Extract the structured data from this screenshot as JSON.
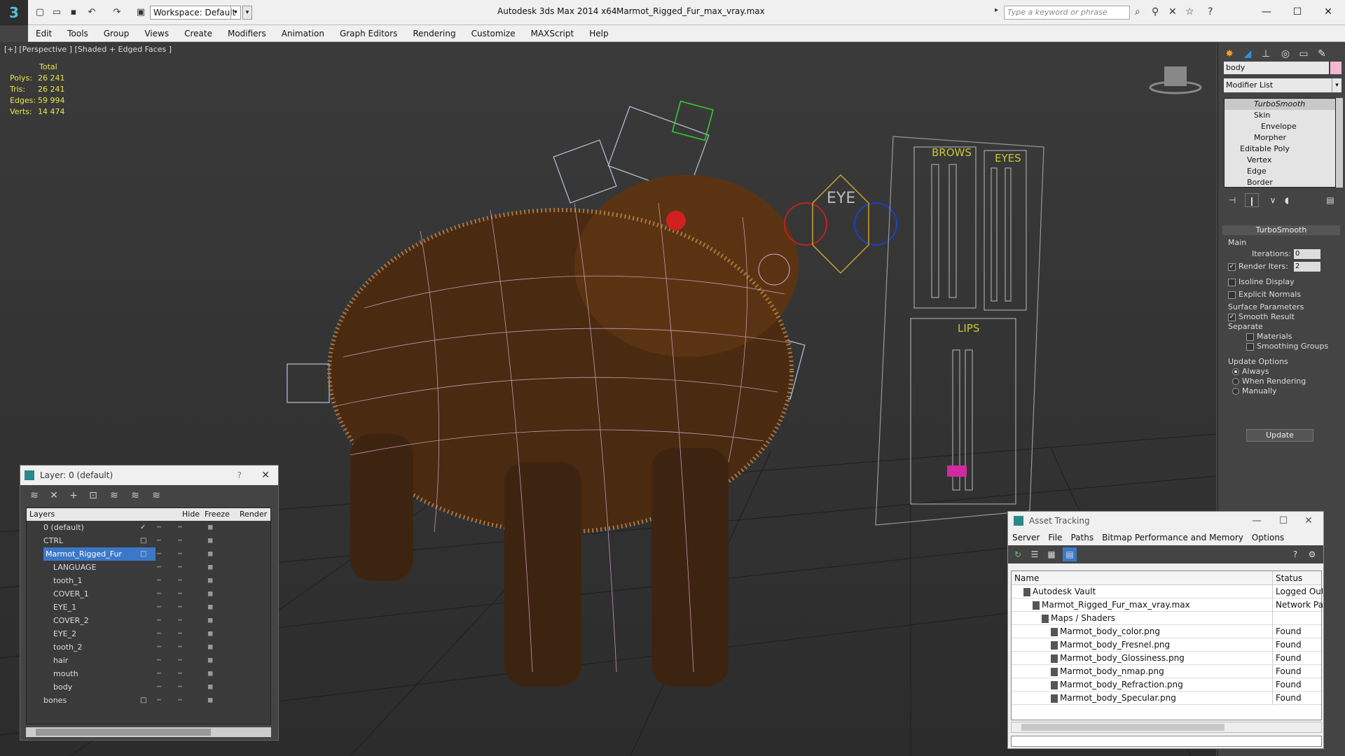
{
  "titlebar": {
    "workspace": "Workspace: Default",
    "app_title": "Autodesk 3ds Max  2014 x64",
    "file_title": "Marmot_Rigged_Fur_max_vray.max",
    "search_placeholder": "Type a keyword or phrase"
  },
  "menu": [
    "Edit",
    "Tools",
    "Group",
    "Views",
    "Create",
    "Modifiers",
    "Animation",
    "Graph Editors",
    "Rendering",
    "Customize",
    "MAXScript",
    "Help"
  ],
  "viewport": {
    "label": "[+] [Perspective ] [Shaded + Edged Faces ]",
    "stats": {
      "header": "Total",
      "rows": [
        [
          "Polys:",
          "26 241"
        ],
        [
          "Tris:",
          "26 241"
        ],
        [
          "Edges:",
          "59 994"
        ],
        [
          "Verts:",
          "14 474"
        ]
      ]
    },
    "board_labels": {
      "brows": "BROWS",
      "eyes": "EYES",
      "lips": "LIPS",
      "eye": "EYE"
    }
  },
  "command_panel": {
    "object_name": "body",
    "object_color": "#f2b8d2",
    "modifier_list": "Modifier List",
    "stack": [
      "TurboSmooth",
      "Skin",
      "Envelope",
      "Morpher",
      "Editable Poly",
      "Vertex",
      "Edge",
      "Border"
    ],
    "rollout": "TurboSmooth",
    "main_label": "Main",
    "iterations_label": "Iterations:",
    "iterations": "0",
    "render_iters_label": "Render Iters:",
    "render_iters": "2",
    "isoline": "Isoline Display",
    "explicit": "Explicit Normals",
    "surface_label": "Surface Parameters",
    "smooth_result": "Smooth Result",
    "separate": "Separate",
    "materials": "Materials",
    "smoothing_groups": "Smoothing Groups",
    "update_options": "Update Options",
    "always": "Always",
    "when_rendering": "When Rendering",
    "manually": "Manually",
    "update_btn": "Update"
  },
  "layer_dialog": {
    "title": "Layer: 0 (default)",
    "help": "?",
    "columns": {
      "layers": "Layers",
      "hide": "Hide",
      "freeze": "Freeze",
      "render": "Render"
    },
    "rows": [
      {
        "name": "0 (default)",
        "indent": 0,
        "check": "✓"
      },
      {
        "name": "CTRL",
        "indent": 0,
        "check": "□"
      },
      {
        "name": "Marmot_Rigged_Fur",
        "indent": 0,
        "check": "□",
        "selected": true
      },
      {
        "name": "LANGUAGE",
        "indent": 1,
        "check": ""
      },
      {
        "name": "tooth_1",
        "indent": 1,
        "check": ""
      },
      {
        "name": "COVER_1",
        "indent": 1,
        "check": ""
      },
      {
        "name": "EYE_1",
        "indent": 1,
        "check": ""
      },
      {
        "name": "COVER_2",
        "indent": 1,
        "check": ""
      },
      {
        "name": "EYE_2",
        "indent": 1,
        "check": ""
      },
      {
        "name": "tooth_2",
        "indent": 1,
        "check": ""
      },
      {
        "name": "hair",
        "indent": 1,
        "check": ""
      },
      {
        "name": "mouth",
        "indent": 1,
        "check": ""
      },
      {
        "name": "body",
        "indent": 1,
        "check": ""
      },
      {
        "name": "bones",
        "indent": 0,
        "check": "□"
      }
    ]
  },
  "asset_tracking": {
    "title": "Asset Tracking",
    "menu": [
      "Server",
      "File",
      "Paths",
      "Bitmap Performance and Memory",
      "Options"
    ],
    "columns": {
      "name": "Name",
      "status": "Status"
    },
    "rows": [
      {
        "name": "Autodesk Vault",
        "indent": 1,
        "status": "Logged Out"
      },
      {
        "name": "Marmot_Rigged_Fur_max_vray.max",
        "indent": 2,
        "status": "Network Pat"
      },
      {
        "name": "Maps / Shaders",
        "indent": 3,
        "status": ""
      },
      {
        "name": "Marmot_body_color.png",
        "indent": 4,
        "status": "Found"
      },
      {
        "name": "Marmot_body_Fresnel.png",
        "indent": 4,
        "status": "Found"
      },
      {
        "name": "Marmot_body_Glossiness.png",
        "indent": 4,
        "status": "Found"
      },
      {
        "name": "Marmot_body_nmap.png",
        "indent": 4,
        "status": "Found"
      },
      {
        "name": "Marmot_body_Refraction.png",
        "indent": 4,
        "status": "Found"
      },
      {
        "name": "Marmot_body_Specular.png",
        "indent": 4,
        "status": "Found"
      }
    ]
  }
}
